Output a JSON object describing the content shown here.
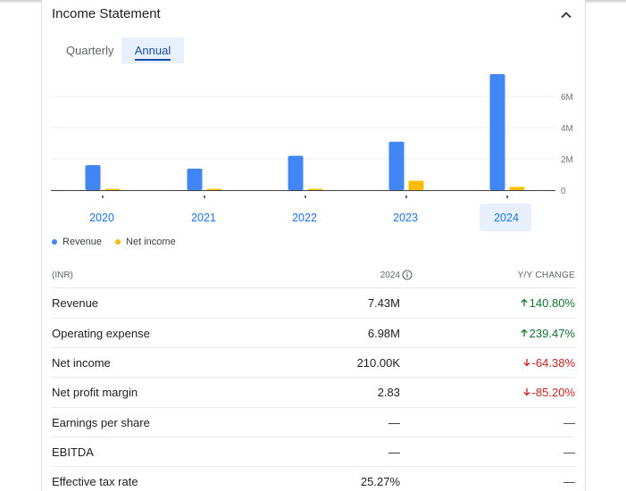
{
  "card": {
    "title": "Income Statement"
  },
  "tabs": [
    {
      "label": "Quarterly",
      "selected": false
    },
    {
      "label": "Annual",
      "selected": true
    }
  ],
  "chart_data": {
    "type": "bar",
    "categories": [
      "2020",
      "2021",
      "2022",
      "2023",
      "2024"
    ],
    "selected_category": "2024",
    "series": [
      {
        "name": "Revenue",
        "color": "#4285f4",
        "values": [
          1.6,
          1.38,
          2.2,
          3.1,
          7.43
        ]
      },
      {
        "name": "Net income",
        "color": "#fbbc04",
        "values": [
          0.05,
          0.05,
          0.03,
          0.6,
          0.21
        ]
      }
    ],
    "ytick_labels": [
      "0",
      "2M",
      "4M",
      "6M"
    ],
    "yticks": [
      0,
      2,
      4,
      6
    ],
    "ylim": [
      0,
      7.6
    ],
    "y_units": "M",
    "grid": true,
    "legend_position": "bottom-left"
  },
  "legend": {
    "revenue": "Revenue",
    "net_income": "Net income"
  },
  "table": {
    "header": {
      "currency": "(INR)",
      "year": "2024",
      "change": "Y/Y CHANGE"
    },
    "rows": [
      {
        "label": "Revenue",
        "value": "7.43M",
        "change": "140.80%",
        "dir": "up"
      },
      {
        "label": "Operating expense",
        "value": "6.98M",
        "change": "239.47%",
        "dir": "up"
      },
      {
        "label": "Net income",
        "value": "210.00K",
        "change": "-64.38%",
        "dir": "down"
      },
      {
        "label": "Net profit margin",
        "value": "2.83",
        "change": "-85.20%",
        "dir": "down"
      },
      {
        "label": "Earnings per share",
        "value": "—",
        "change": "—",
        "dir": "none"
      },
      {
        "label": "EBITDA",
        "value": "—",
        "change": "—",
        "dir": "none"
      },
      {
        "label": "Effective tax rate",
        "value": "25.27%",
        "change": "—",
        "dir": "none"
      }
    ]
  },
  "icons": {
    "collapse": "chevron-up-icon",
    "info": "info-icon",
    "up": "arrow-up-icon",
    "down": "arrow-down-icon"
  }
}
